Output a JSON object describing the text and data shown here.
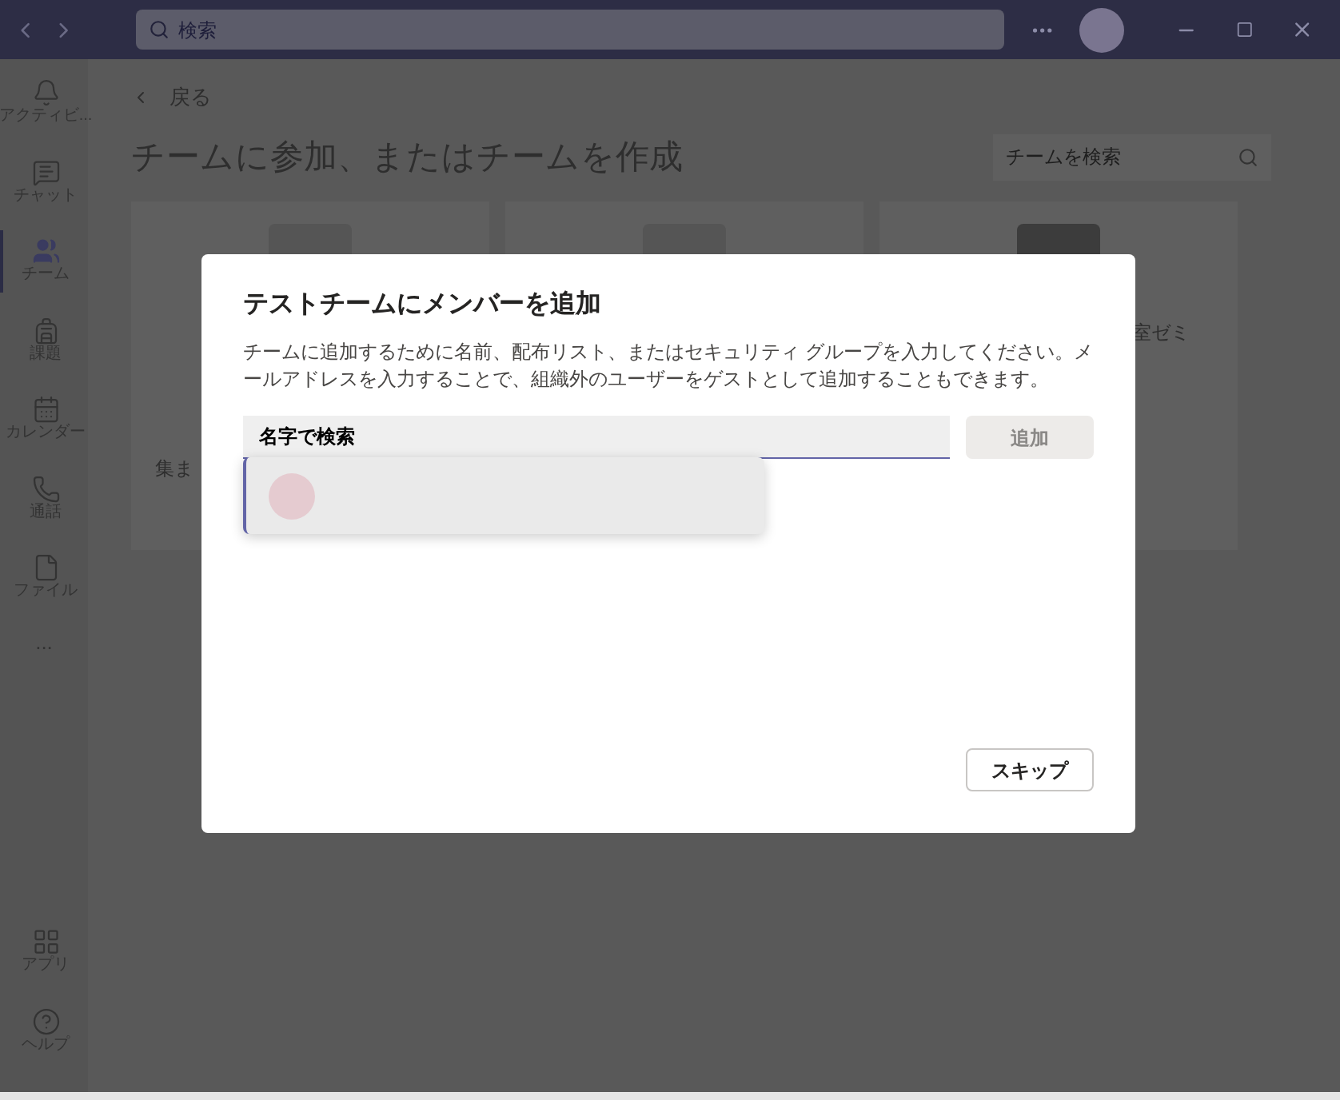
{
  "title_bar": {
    "search": {
      "placeholder": "検索"
    }
  },
  "sidebar": {
    "items": [
      {
        "label": "アクティビ...",
        "selected": false
      },
      {
        "label": "チャット",
        "selected": false
      },
      {
        "label": "チーム",
        "selected": true
      },
      {
        "label": "課題",
        "selected": false
      },
      {
        "label": "カレンダー",
        "selected": false
      },
      {
        "label": "通話",
        "selected": false
      },
      {
        "label": "ファイル",
        "selected": false
      }
    ],
    "more": "...",
    "bottom_items": [
      {
        "label": "アプリ",
        "selected": false
      },
      {
        "label": "ヘルプ",
        "selected": false
      }
    ]
  },
  "page": {
    "back": "戻る",
    "title": "チームに参加、またはチームを作成",
    "team_search": {
      "placeholder": "チームを検索"
    },
    "cards": [
      {
        "kind": "name-below",
        "text": "集ま"
      },
      {
        "kind": "blank"
      },
      {
        "kind": "name-beside",
        "text": "室ゼミ"
      }
    ]
  },
  "dialog": {
    "title": "テストチームにメンバーを追加",
    "description": "チームに追加するために名前、配布リスト、またはセキュリティ グループを入力してください。メールアドレスを入力することで、組織外のユーザーをゲストとして追加することもできます。",
    "field": {
      "value": "名字で検索"
    },
    "add_button": {
      "label": "追加",
      "disabled": true
    },
    "skip_button": "スキップ"
  }
}
